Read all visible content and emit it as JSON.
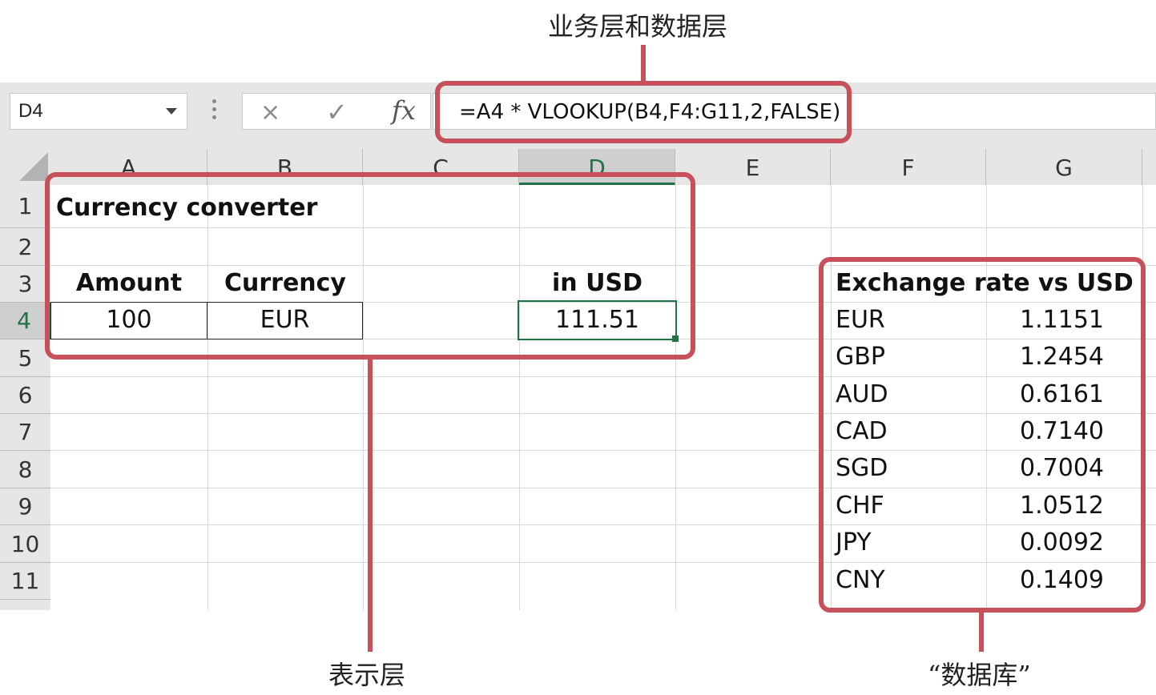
{
  "annotations": {
    "top": "业务层和数据层",
    "bottom_left": "表示层",
    "bottom_right": "“数据库”",
    "highlight_color": "#c7505a"
  },
  "toolbar": {
    "name_box": "D4",
    "cancel_icon": "×",
    "enter_icon": "✓",
    "function_icon": "fx",
    "formula": "=A4 * VLOOKUP(B4,F4:G11,2,FALSE)"
  },
  "columns": [
    "A",
    "B",
    "C",
    "D",
    "E",
    "F",
    "G"
  ],
  "rows": [
    "1",
    "2",
    "3",
    "4",
    "5",
    "6",
    "7",
    "8",
    "9",
    "10",
    "11"
  ],
  "sheet": {
    "title": "Currency converter",
    "amount_header": "Amount",
    "currency_header": "Currency",
    "usd_header": "in USD",
    "amount_value": "100",
    "currency_value": "EUR",
    "usd_value": "111.51",
    "rates_header": "Exchange rate vs USD",
    "rates": [
      {
        "code": "EUR",
        "rate": "1.1151"
      },
      {
        "code": "GBP",
        "rate": "1.2454"
      },
      {
        "code": "AUD",
        "rate": "0.6161"
      },
      {
        "code": "CAD",
        "rate": "0.7140"
      },
      {
        "code": "SGD",
        "rate": "0.7004"
      },
      {
        "code": "CHF",
        "rate": "1.0512"
      },
      {
        "code": "JPY",
        "rate": "0.0092"
      },
      {
        "code": "CNY",
        "rate": "0.1409"
      }
    ]
  },
  "colors": {
    "selection": "#217346",
    "header_bg": "#e6e6e6"
  }
}
